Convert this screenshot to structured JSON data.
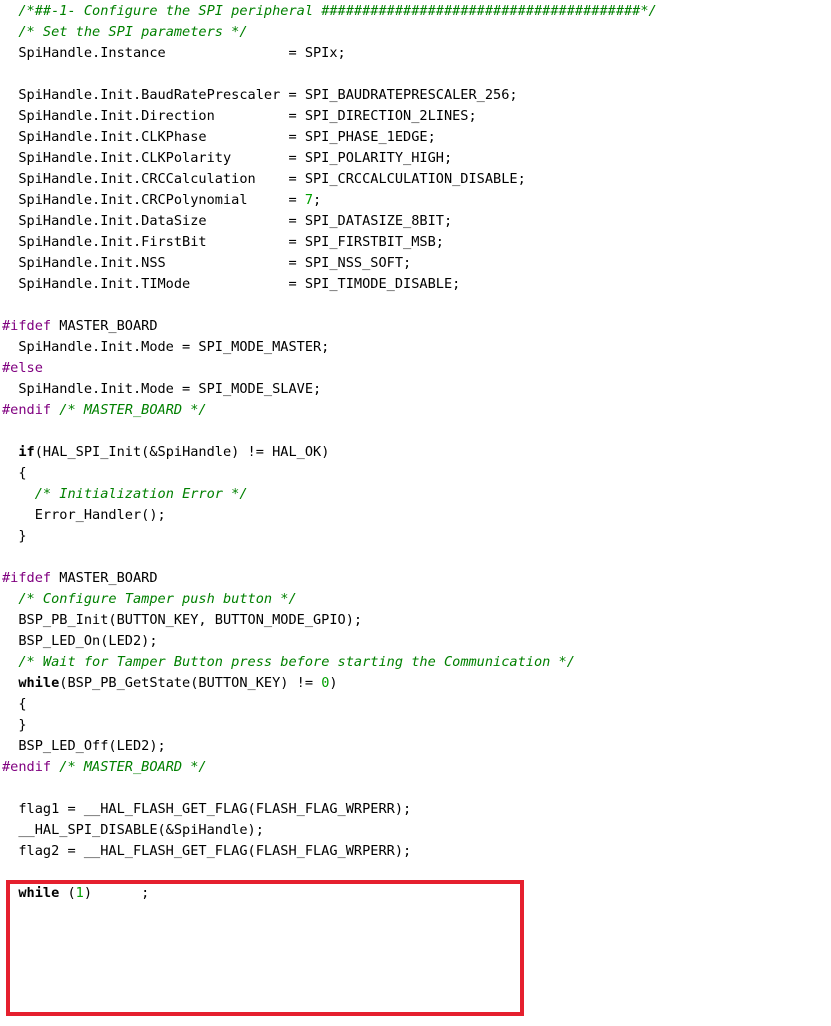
{
  "colors": {
    "default": "#000000",
    "comment": "#008000",
    "preprocessor": "#800080",
    "number": "#00a000",
    "keyword": "#000000",
    "highlight_border": "#e5202e"
  },
  "code": {
    "lines": [
      {
        "tokens": [
          {
            "t": "  ",
            "k": "default"
          },
          {
            "t": "/*##-1- Configure the SPI peripheral #######################################*/",
            "k": "comment"
          }
        ]
      },
      {
        "tokens": [
          {
            "t": "  ",
            "k": "default"
          },
          {
            "t": "/* Set the SPI parameters */",
            "k": "comment"
          }
        ]
      },
      {
        "tokens": [
          {
            "t": "  SpiHandle.Instance               = SPIx;",
            "k": "default"
          }
        ]
      },
      {
        "tokens": []
      },
      {
        "tokens": [
          {
            "t": "  SpiHandle.Init.BaudRatePrescaler = SPI_BAUDRATEPRESCALER_256;",
            "k": "default"
          }
        ]
      },
      {
        "tokens": [
          {
            "t": "  SpiHandle.Init.Direction         = SPI_DIRECTION_2LINES;",
            "k": "default"
          }
        ]
      },
      {
        "tokens": [
          {
            "t": "  SpiHandle.Init.CLKPhase          = SPI_PHASE_1EDGE;",
            "k": "default"
          }
        ]
      },
      {
        "tokens": [
          {
            "t": "  SpiHandle.Init.CLKPolarity       = SPI_POLARITY_HIGH;",
            "k": "default"
          }
        ]
      },
      {
        "tokens": [
          {
            "t": "  SpiHandle.Init.CRCCalculation    = SPI_CRCCALCULATION_DISABLE;",
            "k": "default"
          }
        ]
      },
      {
        "tokens": [
          {
            "t": "  SpiHandle.Init.CRCPolynomial     = ",
            "k": "default"
          },
          {
            "t": "7",
            "k": "number"
          },
          {
            "t": ";",
            "k": "default"
          }
        ]
      },
      {
        "tokens": [
          {
            "t": "  SpiHandle.Init.DataSize          = SPI_DATASIZE_8BIT;",
            "k": "default"
          }
        ]
      },
      {
        "tokens": [
          {
            "t": "  SpiHandle.Init.FirstBit          = SPI_FIRSTBIT_MSB;",
            "k": "default"
          }
        ]
      },
      {
        "tokens": [
          {
            "t": "  SpiHandle.Init.NSS               = SPI_NSS_SOFT;",
            "k": "default"
          }
        ]
      },
      {
        "tokens": [
          {
            "t": "  SpiHandle.Init.TIMode            = SPI_TIMODE_DISABLE;",
            "k": "default"
          }
        ]
      },
      {
        "tokens": []
      },
      {
        "tokens": [
          {
            "t": "#ifdef",
            "k": "preprocessor"
          },
          {
            "t": " MASTER_BOARD",
            "k": "default"
          }
        ]
      },
      {
        "tokens": [
          {
            "t": "  SpiHandle.Init.Mode = SPI_MODE_MASTER;",
            "k": "default"
          }
        ]
      },
      {
        "tokens": [
          {
            "t": "#else",
            "k": "preprocessor"
          }
        ]
      },
      {
        "tokens": [
          {
            "t": "  SpiHandle.Init.Mode = SPI_MODE_SLAVE;",
            "k": "default"
          }
        ]
      },
      {
        "tokens": [
          {
            "t": "#endif",
            "k": "preprocessor"
          },
          {
            "t": " ",
            "k": "default"
          },
          {
            "t": "/* MASTER_BOARD */",
            "k": "comment"
          }
        ]
      },
      {
        "tokens": []
      },
      {
        "tokens": [
          {
            "t": "  ",
            "k": "default"
          },
          {
            "t": "if",
            "k": "keyword"
          },
          {
            "t": "(HAL_SPI_Init(&SpiHandle) != HAL_OK)",
            "k": "default"
          }
        ]
      },
      {
        "tokens": [
          {
            "t": "  {",
            "k": "default"
          }
        ]
      },
      {
        "tokens": [
          {
            "t": "    ",
            "k": "default"
          },
          {
            "t": "/* Initialization Error */",
            "k": "comment"
          }
        ]
      },
      {
        "tokens": [
          {
            "t": "    Error_Handler();",
            "k": "default"
          }
        ]
      },
      {
        "tokens": [
          {
            "t": "  }",
            "k": "default"
          }
        ]
      },
      {
        "tokens": []
      },
      {
        "tokens": [
          {
            "t": "#ifdef",
            "k": "preprocessor"
          },
          {
            "t": " MASTER_BOARD",
            "k": "default"
          }
        ]
      },
      {
        "tokens": [
          {
            "t": "  ",
            "k": "default"
          },
          {
            "t": "/* Configure Tamper push button */",
            "k": "comment"
          }
        ]
      },
      {
        "tokens": [
          {
            "t": "  BSP_PB_Init(BUTTON_KEY, BUTTON_MODE_GPIO);",
            "k": "default"
          }
        ]
      },
      {
        "tokens": [
          {
            "t": "  BSP_LED_On(LED2);",
            "k": "default"
          }
        ]
      },
      {
        "tokens": [
          {
            "t": "  ",
            "k": "default"
          },
          {
            "t": "/* Wait for Tamper Button press before starting the Communication */",
            "k": "comment"
          }
        ]
      },
      {
        "tokens": [
          {
            "t": "  ",
            "k": "default"
          },
          {
            "t": "while",
            "k": "keyword"
          },
          {
            "t": "(BSP_PB_GetState(BUTTON_KEY) != ",
            "k": "default"
          },
          {
            "t": "0",
            "k": "number"
          },
          {
            "t": ")",
            "k": "default"
          }
        ]
      },
      {
        "tokens": [
          {
            "t": "  {",
            "k": "default"
          }
        ]
      },
      {
        "tokens": [
          {
            "t": "  }",
            "k": "default"
          }
        ]
      },
      {
        "tokens": [
          {
            "t": "  BSP_LED_Off(LED2);",
            "k": "default"
          }
        ]
      },
      {
        "tokens": [
          {
            "t": "#endif",
            "k": "preprocessor"
          },
          {
            "t": " ",
            "k": "default"
          },
          {
            "t": "/* MASTER_BOARD */",
            "k": "comment"
          }
        ]
      },
      {
        "tokens": []
      },
      {
        "tokens": [
          {
            "t": "  flag1 = __HAL_FLASH_GET_FLAG(FLASH_FLAG_WRPERR);",
            "k": "default"
          }
        ]
      },
      {
        "tokens": [
          {
            "t": "  __HAL_SPI_DISABLE(&SpiHandle);",
            "k": "default"
          }
        ]
      },
      {
        "tokens": [
          {
            "t": "  flag2 = __HAL_FLASH_GET_FLAG(FLASH_FLAG_WRPERR);",
            "k": "default"
          }
        ]
      },
      {
        "tokens": []
      },
      {
        "tokens": [
          {
            "t": "  ",
            "k": "default"
          },
          {
            "t": "while",
            "k": "keyword"
          },
          {
            "t": " (",
            "k": "default"
          },
          {
            "t": "1",
            "k": "number"
          },
          {
            "t": ")      ;",
            "k": "default"
          }
        ]
      }
    ]
  }
}
